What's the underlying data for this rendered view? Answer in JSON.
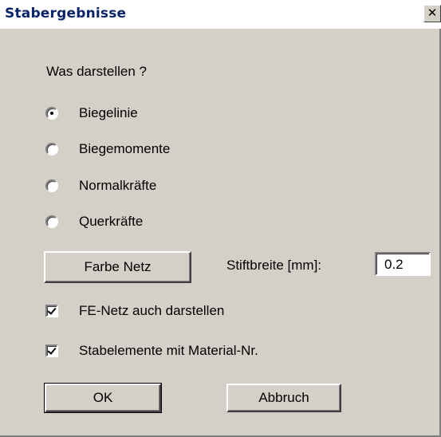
{
  "window": {
    "title": "Stabergebnisse",
    "close_glyph": "✕"
  },
  "prompt": "Was darstellen ?",
  "display_options": [
    {
      "label": "Biegelinie",
      "selected": true
    },
    {
      "label": "Biegemomente",
      "selected": false
    },
    {
      "label": "Normalkräfte",
      "selected": false
    },
    {
      "label": "Querkräfte",
      "selected": false
    }
  ],
  "color_button": {
    "label": "Farbe Netz"
  },
  "pen_width": {
    "label": "Stiftbreite [mm]:",
    "value": "0.2"
  },
  "checkboxes": [
    {
      "label": "FE-Netz auch darstellen",
      "checked": true
    },
    {
      "label": "Stabelemente mit Material-Nr.",
      "checked": true
    }
  ],
  "buttons": {
    "ok": "OK",
    "cancel": "Abbruch"
  }
}
